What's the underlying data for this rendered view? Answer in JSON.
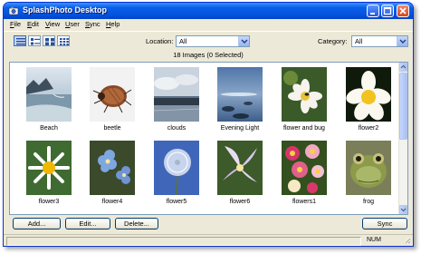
{
  "window": {
    "title": "SplashPhoto Desktop"
  },
  "menu": [
    {
      "label": "File",
      "u": "F",
      "rest": "ile"
    },
    {
      "label": "Edit",
      "u": "E",
      "rest": "dit"
    },
    {
      "label": "View",
      "u": "V",
      "rest": "iew"
    },
    {
      "label": "User",
      "u": "U",
      "rest": "ser"
    },
    {
      "label": "Sync",
      "u": "S",
      "rest": "ync"
    },
    {
      "label": "Help",
      "u": "H",
      "rest": "elp"
    }
  ],
  "toolbar": {
    "location_label": "Location:",
    "location_value": "All",
    "category_label": "Category:",
    "category_value": "All"
  },
  "gallery": {
    "count_text": "18 Images (0 Selected)",
    "images": [
      {
        "name": "Beach"
      },
      {
        "name": "beetle"
      },
      {
        "name": "clouds"
      },
      {
        "name": "Evening Light"
      },
      {
        "name": "flower and bug"
      },
      {
        "name": "flower2"
      },
      {
        "name": "flower3"
      },
      {
        "name": "flower4"
      },
      {
        "name": "flower5"
      },
      {
        "name": "flower6"
      },
      {
        "name": "flowers1"
      },
      {
        "name": "frog"
      }
    ]
  },
  "buttons": {
    "add": "Add...",
    "edit": "Edit...",
    "delete": "Delete...",
    "sync": "Sync"
  },
  "status": {
    "num": "NUM"
  },
  "colors": {
    "titlebar": "#0453e0",
    "window_bg": "#ece9d8",
    "selected_view": "#c4d7f5"
  }
}
